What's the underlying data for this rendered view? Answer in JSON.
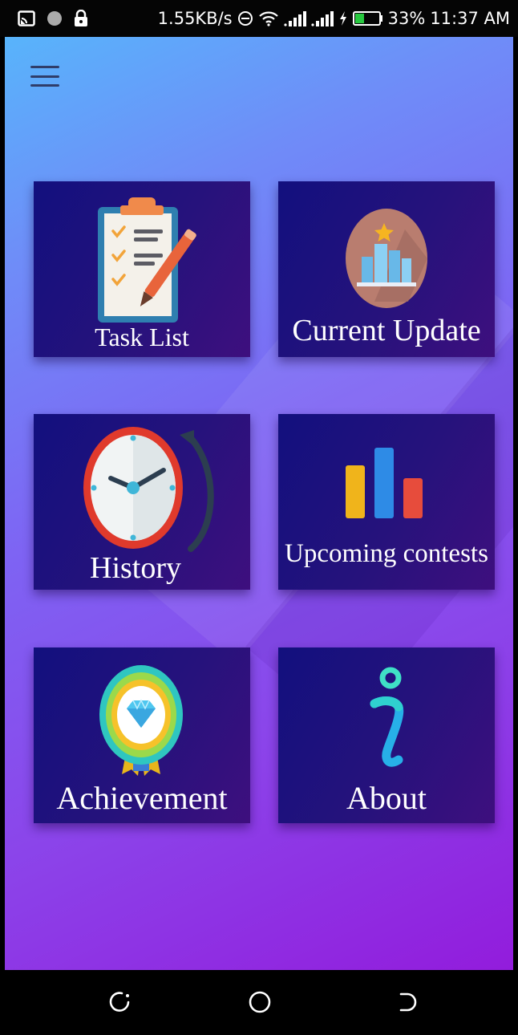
{
  "status_bar": {
    "net_speed": "1.55KB/s",
    "battery_percent": "33%",
    "time": "11:37 AM"
  },
  "tiles": [
    {
      "label": "Task List",
      "icon": "clipboard-checklist-icon"
    },
    {
      "label": "Current Update",
      "icon": "podium-star-icon"
    },
    {
      "label": "History",
      "icon": "clock-history-icon"
    },
    {
      "label": "Upcoming contests",
      "icon": "bar-chart-icon"
    },
    {
      "label": "Achievement",
      "icon": "diamond-badge-icon"
    },
    {
      "label": "About",
      "icon": "info-icon"
    }
  ],
  "colors": {
    "tile_bg": "#1b127e",
    "gradient_top": "#58b4fb",
    "gradient_bottom": "#921cdc"
  }
}
